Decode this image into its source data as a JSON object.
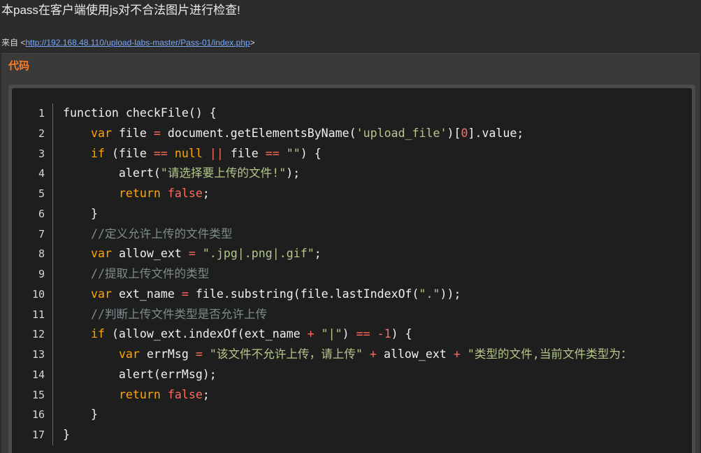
{
  "header": {
    "title": "本pass在客户端使用js对不合法图片进行检查!",
    "source_prefix": "来自 <",
    "source_url": "http://192.168.48.110/upload-labs-master/Pass-01/index.php",
    "source_suffix": ">"
  },
  "panel": {
    "title": "代码"
  },
  "code": {
    "line_numbers": [
      "1",
      "2",
      "3",
      "4",
      "5",
      "6",
      "7",
      "8",
      "9",
      "10",
      "11",
      "12",
      "13",
      "14",
      "15",
      "16",
      "17"
    ],
    "lines": [
      [
        {
          "t": "function checkFile() {",
          "c": ""
        }
      ],
      [
        {
          "t": "    ",
          "c": ""
        },
        {
          "t": "var",
          "c": "kw"
        },
        {
          "t": " file ",
          "c": ""
        },
        {
          "t": "=",
          "c": "op"
        },
        {
          "t": " document.getElementsByName(",
          "c": ""
        },
        {
          "t": "'upload_file'",
          "c": "str"
        },
        {
          "t": ")[",
          "c": ""
        },
        {
          "t": "0",
          "c": "num"
        },
        {
          "t": "].value;",
          "c": ""
        }
      ],
      [
        {
          "t": "    ",
          "c": ""
        },
        {
          "t": "if",
          "c": "kw"
        },
        {
          "t": " (file ",
          "c": ""
        },
        {
          "t": "==",
          "c": "op"
        },
        {
          "t": " ",
          "c": ""
        },
        {
          "t": "null",
          "c": "kw"
        },
        {
          "t": " ",
          "c": ""
        },
        {
          "t": "||",
          "c": "op"
        },
        {
          "t": " file ",
          "c": ""
        },
        {
          "t": "==",
          "c": "op"
        },
        {
          "t": " ",
          "c": ""
        },
        {
          "t": "\"\"",
          "c": "str"
        },
        {
          "t": ") {",
          "c": ""
        }
      ],
      [
        {
          "t": "        alert(",
          "c": ""
        },
        {
          "t": "\"请选择要上传的文件!\"",
          "c": "str"
        },
        {
          "t": ");",
          "c": ""
        }
      ],
      [
        {
          "t": "        ",
          "c": ""
        },
        {
          "t": "return",
          "c": "kw"
        },
        {
          "t": " ",
          "c": ""
        },
        {
          "t": "false",
          "c": "bool"
        },
        {
          "t": ";",
          "c": ""
        }
      ],
      [
        {
          "t": "    }",
          "c": ""
        }
      ],
      [
        {
          "t": "    ",
          "c": ""
        },
        {
          "t": "//定义允许上传的文件类型",
          "c": "cmt"
        }
      ],
      [
        {
          "t": "    ",
          "c": ""
        },
        {
          "t": "var",
          "c": "kw"
        },
        {
          "t": " allow_ext ",
          "c": ""
        },
        {
          "t": "=",
          "c": "op"
        },
        {
          "t": " ",
          "c": ""
        },
        {
          "t": "\".jpg|.png|.gif\"",
          "c": "str"
        },
        {
          "t": ";",
          "c": ""
        }
      ],
      [
        {
          "t": "    ",
          "c": ""
        },
        {
          "t": "//提取上传文件的类型",
          "c": "cmt"
        }
      ],
      [
        {
          "t": "    ",
          "c": ""
        },
        {
          "t": "var",
          "c": "kw"
        },
        {
          "t": " ext_name ",
          "c": ""
        },
        {
          "t": "=",
          "c": "op"
        },
        {
          "t": " file.substring(file.lastIndexOf(",
          "c": ""
        },
        {
          "t": "\".\"",
          "c": "str"
        },
        {
          "t": "));",
          "c": ""
        }
      ],
      [
        {
          "t": "    ",
          "c": ""
        },
        {
          "t": "//判断上传文件类型是否允许上传",
          "c": "cmt"
        }
      ],
      [
        {
          "t": "    ",
          "c": ""
        },
        {
          "t": "if",
          "c": "kw"
        },
        {
          "t": " (allow_ext.indexOf(ext_name ",
          "c": ""
        },
        {
          "t": "+",
          "c": "op"
        },
        {
          "t": " ",
          "c": ""
        },
        {
          "t": "\"|\"",
          "c": "str"
        },
        {
          "t": ") ",
          "c": ""
        },
        {
          "t": "==",
          "c": "op"
        },
        {
          "t": " ",
          "c": ""
        },
        {
          "t": "-1",
          "c": "num"
        },
        {
          "t": ") {",
          "c": ""
        }
      ],
      [
        {
          "t": "        ",
          "c": ""
        },
        {
          "t": "var",
          "c": "kw"
        },
        {
          "t": " errMsg ",
          "c": ""
        },
        {
          "t": "=",
          "c": "op"
        },
        {
          "t": " ",
          "c": ""
        },
        {
          "t": "\"该文件不允许上传，请上传\"",
          "c": "str"
        },
        {
          "t": " ",
          "c": ""
        },
        {
          "t": "+",
          "c": "op"
        },
        {
          "t": " allow_ext ",
          "c": ""
        },
        {
          "t": "+",
          "c": "op"
        },
        {
          "t": " ",
          "c": ""
        },
        {
          "t": "\"类型的文件,当前文件类型为：",
          "c": "str"
        }
      ],
      [
        {
          "t": "        alert(errMsg);",
          "c": ""
        }
      ],
      [
        {
          "t": "        ",
          "c": ""
        },
        {
          "t": "return",
          "c": "kw"
        },
        {
          "t": " ",
          "c": ""
        },
        {
          "t": "false",
          "c": "bool"
        },
        {
          "t": ";",
          "c": ""
        }
      ],
      [
        {
          "t": "    }",
          "c": ""
        }
      ],
      [
        {
          "t": "}",
          "c": ""
        }
      ]
    ]
  }
}
